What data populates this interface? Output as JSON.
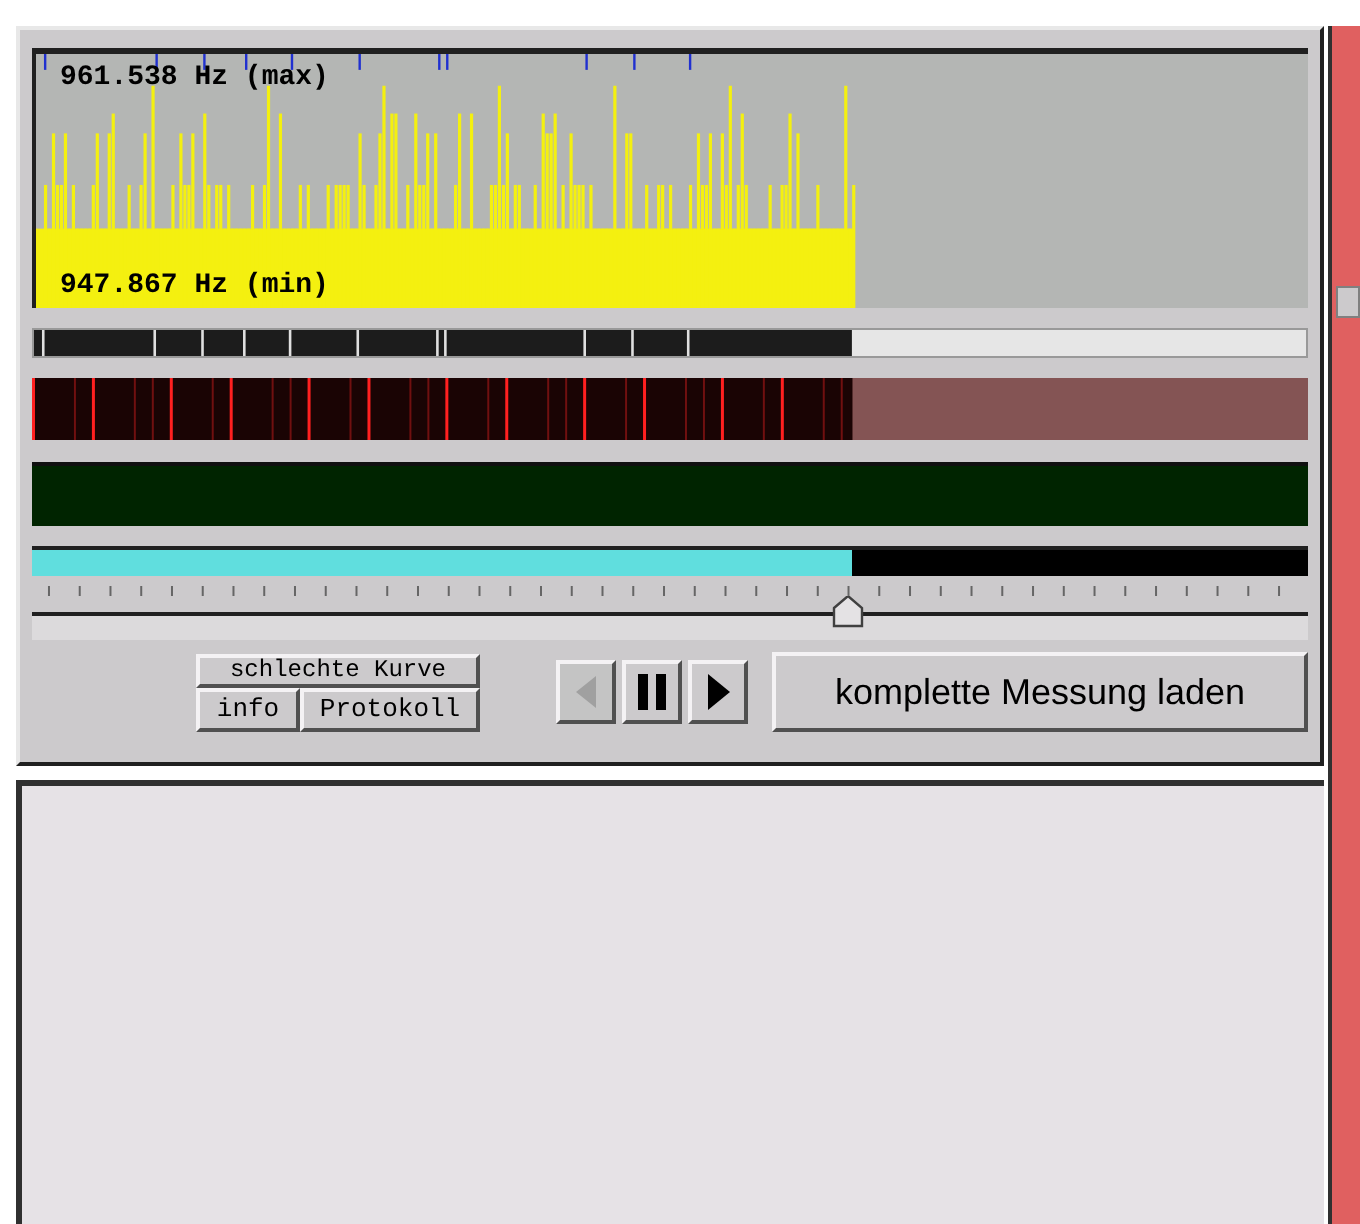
{
  "chart": {
    "max_label": "961.538 Hz (max)",
    "min_label": "947.867 Hz (min)"
  },
  "progress": {
    "level": 0.643
  },
  "slider": {
    "level": 0.64
  },
  "buttons": {
    "bad_curve": "schlechte Kurve",
    "info": "info",
    "protocol": "Protokoll",
    "load": "komplette Messung laden"
  },
  "transport": [
    {
      "kind": "back",
      "disabled": true
    },
    {
      "kind": "pause",
      "disabled": false
    },
    {
      "kind": "play",
      "disabled": false
    }
  ]
}
